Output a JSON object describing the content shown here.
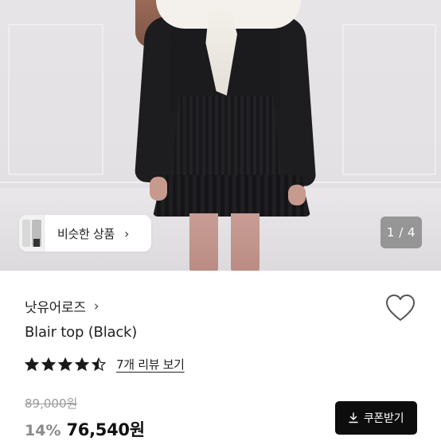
{
  "hero": {
    "similar_label": "비슷한 상품",
    "similar_chevron": "›",
    "counter": "1 / 4"
  },
  "product": {
    "brand": "낫유어로즈",
    "brand_chevron": "›",
    "title": "Blair top (Black)",
    "rating": 4.5,
    "rating_max": 5,
    "reviews_link": "7개 리뷰 보기",
    "original_price": "89,000원",
    "discount": "14%",
    "price": "76,540원",
    "coupon_label": "쿠폰받기"
  },
  "icons": {
    "heart": "heart-outline-icon",
    "star": "star-icon",
    "download": "download-icon"
  },
  "colors": {
    "star": "#1a1a1a",
    "coupon_bg": "#0d0d0d",
    "discount": "#8a8a8a",
    "counter_bg": "#787878"
  }
}
